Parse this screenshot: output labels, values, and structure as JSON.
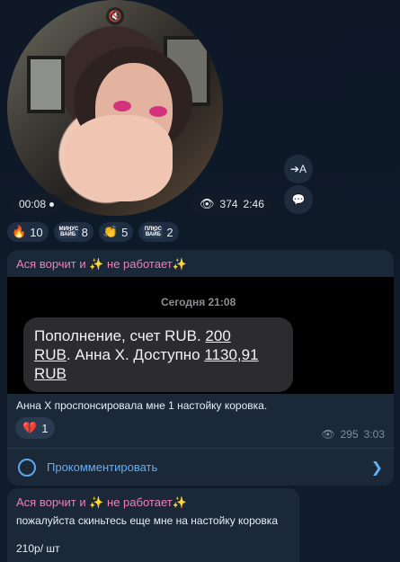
{
  "video": {
    "duration": "00:08",
    "views": "374",
    "time": "2:46",
    "mute_icon": "mute-icon"
  },
  "side_buttons": {
    "forward_label": "➔A",
    "comment_icon": "comment-icon"
  },
  "reactions": [
    {
      "icon": "🔥",
      "count": "10"
    },
    {
      "icon_text": "МИНУС ВАЙБ",
      "count": "8"
    },
    {
      "icon": "👏",
      "count": "5"
    },
    {
      "icon_text": "ПЛЮС ВАЙБ",
      "count": "2"
    }
  ],
  "post1": {
    "author": "Ася ворчит и ✨ не работает✨",
    "screenshot": {
      "date": "Сегодня 21:08",
      "line1": "Пополнение, счет RUB. ",
      "amount": "200",
      "line2_u": "RUB",
      "line2": ". Анна Х. Доступно ",
      "balance": "1130,91",
      "line3_u": "RUB"
    },
    "caption": "Анна Х проспонсировала мне 1 настойку коровка.",
    "reaction_icon": "💔",
    "reaction_count": "1",
    "views": "295",
    "time": "3:03",
    "comment_label": "Прокомментировать"
  },
  "post2": {
    "author": "Ася ворчит и ✨ не работает✨",
    "text": "пожалуйста скиньтесь еще мне на настойку коровка",
    "price": "210р/ шт"
  },
  "colors": {
    "background": "#0f1a2a",
    "bubble": "#1b2837",
    "author": "#f07fb7",
    "link": "#64aef5"
  }
}
